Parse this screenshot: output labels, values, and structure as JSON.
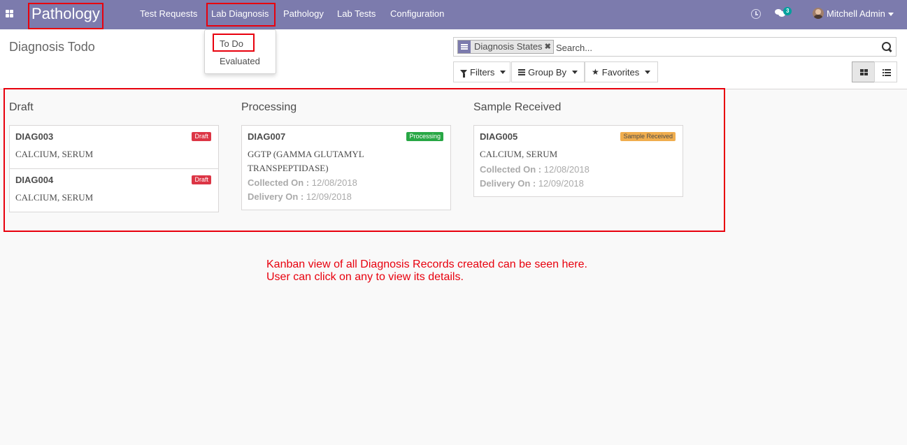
{
  "navbar": {
    "app_title": "Pathology",
    "menu": [
      "Test Requests",
      "Lab Diagnosis",
      "Pathology",
      "Lab Tests",
      "Configuration"
    ],
    "chat_count": "3",
    "user_name": "Mitchell Admin",
    "colors": {
      "bar": "#7c7bad",
      "highlight": "#e8000d"
    },
    "icons": [
      "apps-icon",
      "clock-icon",
      "chat-icon",
      "avatar",
      "chevron-down-icon"
    ]
  },
  "dropdown": {
    "items": [
      "To Do",
      "Evaluated"
    ]
  },
  "control_panel": {
    "page_title": "Diagnosis Todo",
    "facet_label": "Diagnosis States",
    "search_placeholder": "Search...",
    "filters_label": "Filters",
    "group_by_label": "Group By",
    "favorites_label": "Favorites",
    "active_view": "kanban"
  },
  "kanban": {
    "columns": [
      {
        "title": "Draft",
        "cards": [
          {
            "ref": "DIAG003",
            "tag": "Draft",
            "test": "CALCIUM, SERUM"
          },
          {
            "ref": "DIAG004",
            "tag": "Draft",
            "test": "CALCIUM, SERUM"
          }
        ]
      },
      {
        "title": "Processing",
        "cards": [
          {
            "ref": "DIAG007",
            "tag": "Processing",
            "test": "GGTP (GAMMA GLUTAMYL TRANSPEPTIDASE)",
            "collected_label": "Collected On :",
            "collected": "12/08/2018",
            "delivery_label": "Delivery On :",
            "delivery": "12/09/2018"
          }
        ]
      },
      {
        "title": "Sample Received",
        "cards": [
          {
            "ref": "DIAG005",
            "tag": "Sample Received",
            "test": "CALCIUM, SERUM",
            "collected_label": "Collected On :",
            "collected": "12/08/2018",
            "delivery_label": "Delivery On :",
            "delivery": "12/09/2018"
          }
        ]
      }
    ]
  },
  "annotation": {
    "line1": "Kanban view of all Diagnosis Records created can be seen here.",
    "line2": "User can click on any to view its details."
  }
}
